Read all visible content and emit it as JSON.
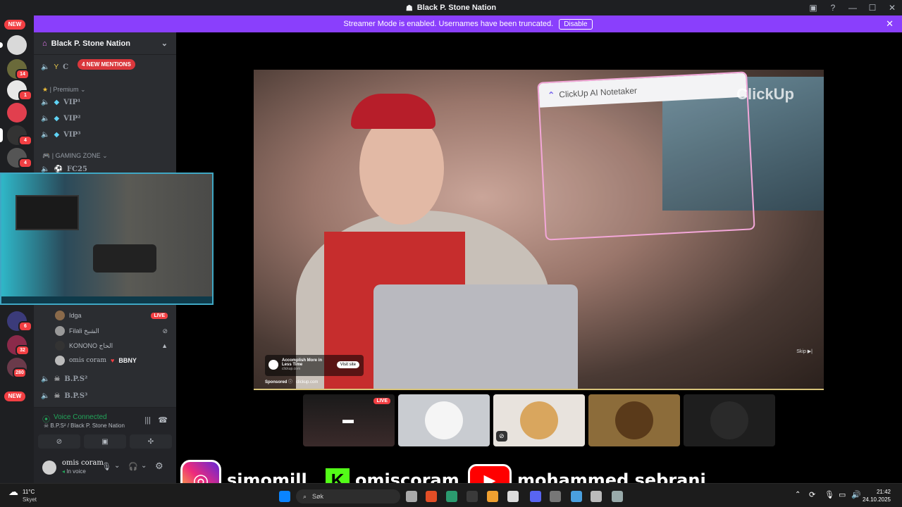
{
  "window": {
    "title": "Black P. Stone Nation"
  },
  "banner": {
    "text": "Streamer Mode is enabled. Usernames have been truncated.",
    "button": "Disable"
  },
  "rail": {
    "new_top": "NEW",
    "new_bottom": "NEW",
    "counts": [
      "14",
      "1",
      "4",
      "4",
      "6",
      "6",
      "32",
      "280"
    ]
  },
  "server": {
    "name": "Black P. Stone Nation"
  },
  "channels": {
    "mentions": "4 NEW MENTIONS",
    "first_channel": "C",
    "premium_category": "| Premium",
    "vip": [
      "VIP¹",
      "VIP²",
      "VIP³"
    ],
    "gaming_category": "| GAMING ZONE",
    "fc25": "FC25",
    "bps2": "B.P.S²",
    "bps3": "B.P.S³"
  },
  "members": [
    {
      "name": "Idga",
      "tag": "LIVE"
    },
    {
      "name": "Filali الشيخ",
      "tag": ""
    },
    {
      "name": "KONONO الحاج",
      "tag": ""
    },
    {
      "name": "omis coram",
      "tag": "BBNY"
    }
  ],
  "voice": {
    "status": "Voice Connected",
    "channel": "B.P.S² / Black P. Stone Nation"
  },
  "user": {
    "name": "omis coram",
    "status": "In voice"
  },
  "ad": {
    "headline": "Accomplish More in Less Time",
    "site": "clickup.com",
    "button": "Visit site",
    "sponsored": "Sponsored",
    "sponsored_site": "clickup.com",
    "skip": "Skip"
  },
  "clickup": {
    "card_title": "ClickUp AI Notetaker",
    "logo": "ClickUp"
  },
  "thumbs": {
    "live": "LIVE"
  },
  "social": {
    "instagram": "simomill",
    "kick": "omiscoram",
    "youtube": "mohammed sebrani"
  },
  "taskbar": {
    "search": "Søk",
    "weather_temp": "11°C",
    "weather_desc": "Skyet",
    "time": "21:42",
    "date": "24.10.2025"
  },
  "colors": {
    "streamer_banner": "#8a3ffc",
    "voice_green": "#23a55a",
    "mention_red": "#da373c"
  }
}
